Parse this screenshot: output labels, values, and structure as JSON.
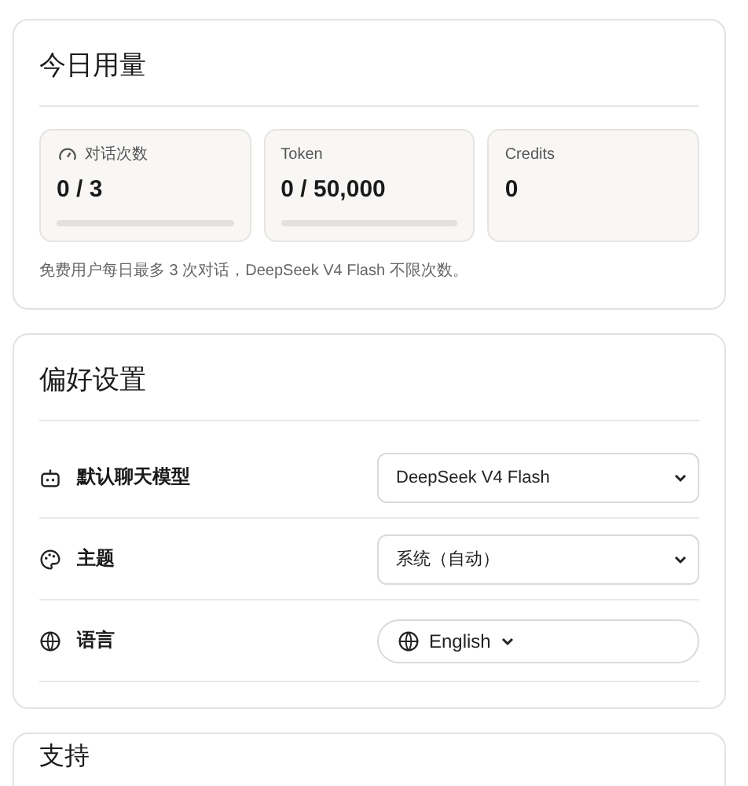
{
  "usage": {
    "title": "今日用量",
    "stats": [
      {
        "label": "对话次数",
        "value": "0 / 3",
        "level": 0
      },
      {
        "label": "Token",
        "value": "0 / 50,000",
        "level": 0
      },
      {
        "label": "Credits",
        "value": "0"
      }
    ],
    "note": "免费用户每日最多 3 次对话，DeepSeek V4 Flash 不限次数。"
  },
  "preferences": {
    "title": "偏好设置",
    "rows": [
      {
        "label": "默认聊天模型",
        "kind": "select",
        "value": "DeepSeek V4 Flash"
      },
      {
        "label": "主题",
        "kind": "select",
        "value": "系统（自动）"
      },
      {
        "label": "语言",
        "kind": "pill",
        "value": "English"
      }
    ]
  },
  "support": {
    "title": "支持"
  }
}
